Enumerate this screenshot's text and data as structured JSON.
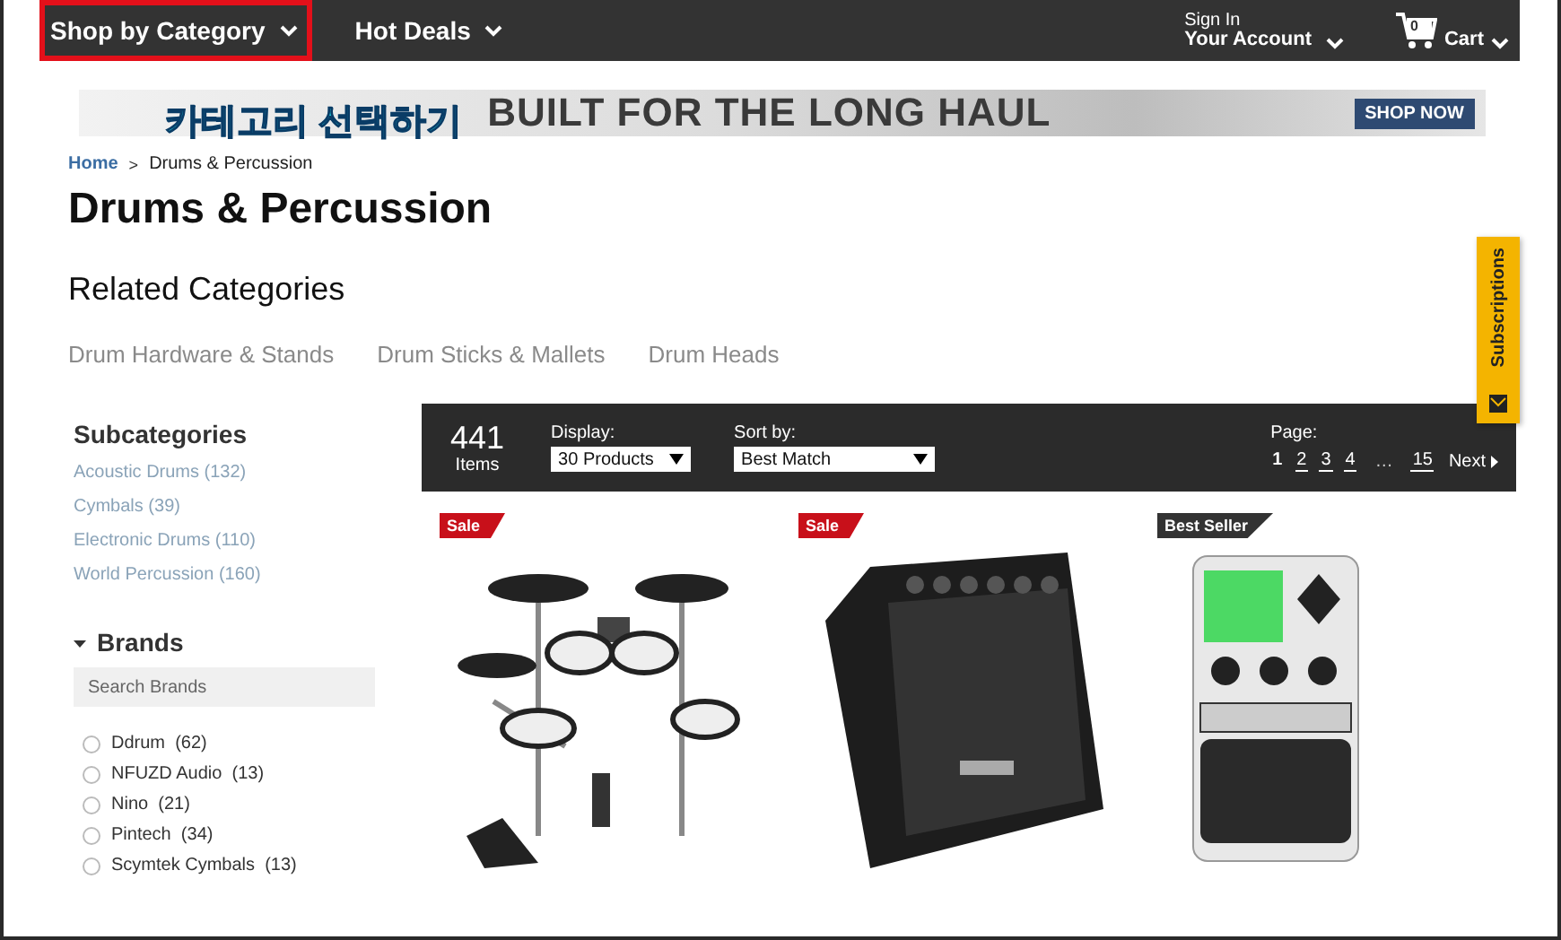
{
  "nav": {
    "items": [
      {
        "label": "Shop by Category",
        "highlighted": true
      },
      {
        "label": "Hot Deals",
        "highlighted": false
      }
    ],
    "account": {
      "line1": "Sign In",
      "line2": "Your Account"
    },
    "cart": {
      "count": "0",
      "label": "Cart"
    }
  },
  "banner": {
    "headline": "BUILT FOR THE LONG HAUL",
    "button": "SHOP NOW"
  },
  "annotation": "카테고리 선택하기",
  "breadcrumb": {
    "items": [
      "Home",
      "Drums & Percussion"
    ],
    "separator": ">"
  },
  "title": "Drums & Percussion",
  "related": {
    "heading": "Related Categories",
    "items": [
      "Drum Hardware & Stands",
      "Drum Sticks & Mallets",
      "Drum Heads"
    ]
  },
  "sidebar": {
    "subcategories": {
      "heading": "Subcategories",
      "items": [
        "Acoustic Drums (132)",
        "Cymbals (39)",
        "Electronic Drums (110)",
        "World Percussion (160)"
      ]
    },
    "brands": {
      "heading": "Brands",
      "expanded": true,
      "search": {
        "placeholder": "Search Brands"
      },
      "items": [
        {
          "label": "Ddrum",
          "count": "(62)",
          "checked": false
        },
        {
          "label": "NFUZD Audio",
          "count": "(13)",
          "checked": false
        },
        {
          "label": "Nino",
          "count": "(21)",
          "checked": false
        },
        {
          "label": "Pintech",
          "count": "(34)",
          "checked": false
        },
        {
          "label": "Scymtek Cymbals",
          "count": "(13)",
          "checked": false
        }
      ]
    }
  },
  "toolbar": {
    "count": "441",
    "count_label": "Items",
    "display": {
      "label": "Display:",
      "value": "30 Products"
    },
    "sort": {
      "label": "Sort by:",
      "value": "Best Match"
    },
    "page": {
      "label": "Page:",
      "pages": [
        {
          "label": "1",
          "selected": true
        },
        {
          "label": "2",
          "selected": false
        },
        {
          "label": "3",
          "selected": false
        },
        {
          "label": "4",
          "selected": false
        }
      ],
      "ellipsis": "…",
      "last_pages": [
        {
          "label": "15",
          "selected": false
        }
      ],
      "next": "Next"
    }
  },
  "products": [
    {
      "badge": {
        "label": "Sale",
        "kind": "sale"
      },
      "kind": "drum-kit"
    },
    {
      "badge": {
        "label": "Sale",
        "kind": "sale"
      },
      "kind": "amplifier"
    },
    {
      "badge": {
        "label": "Best Seller",
        "kind": "best-seller"
      },
      "kind": "pedal"
    }
  ],
  "subscriptions": {
    "label": "Subscriptions"
  }
}
